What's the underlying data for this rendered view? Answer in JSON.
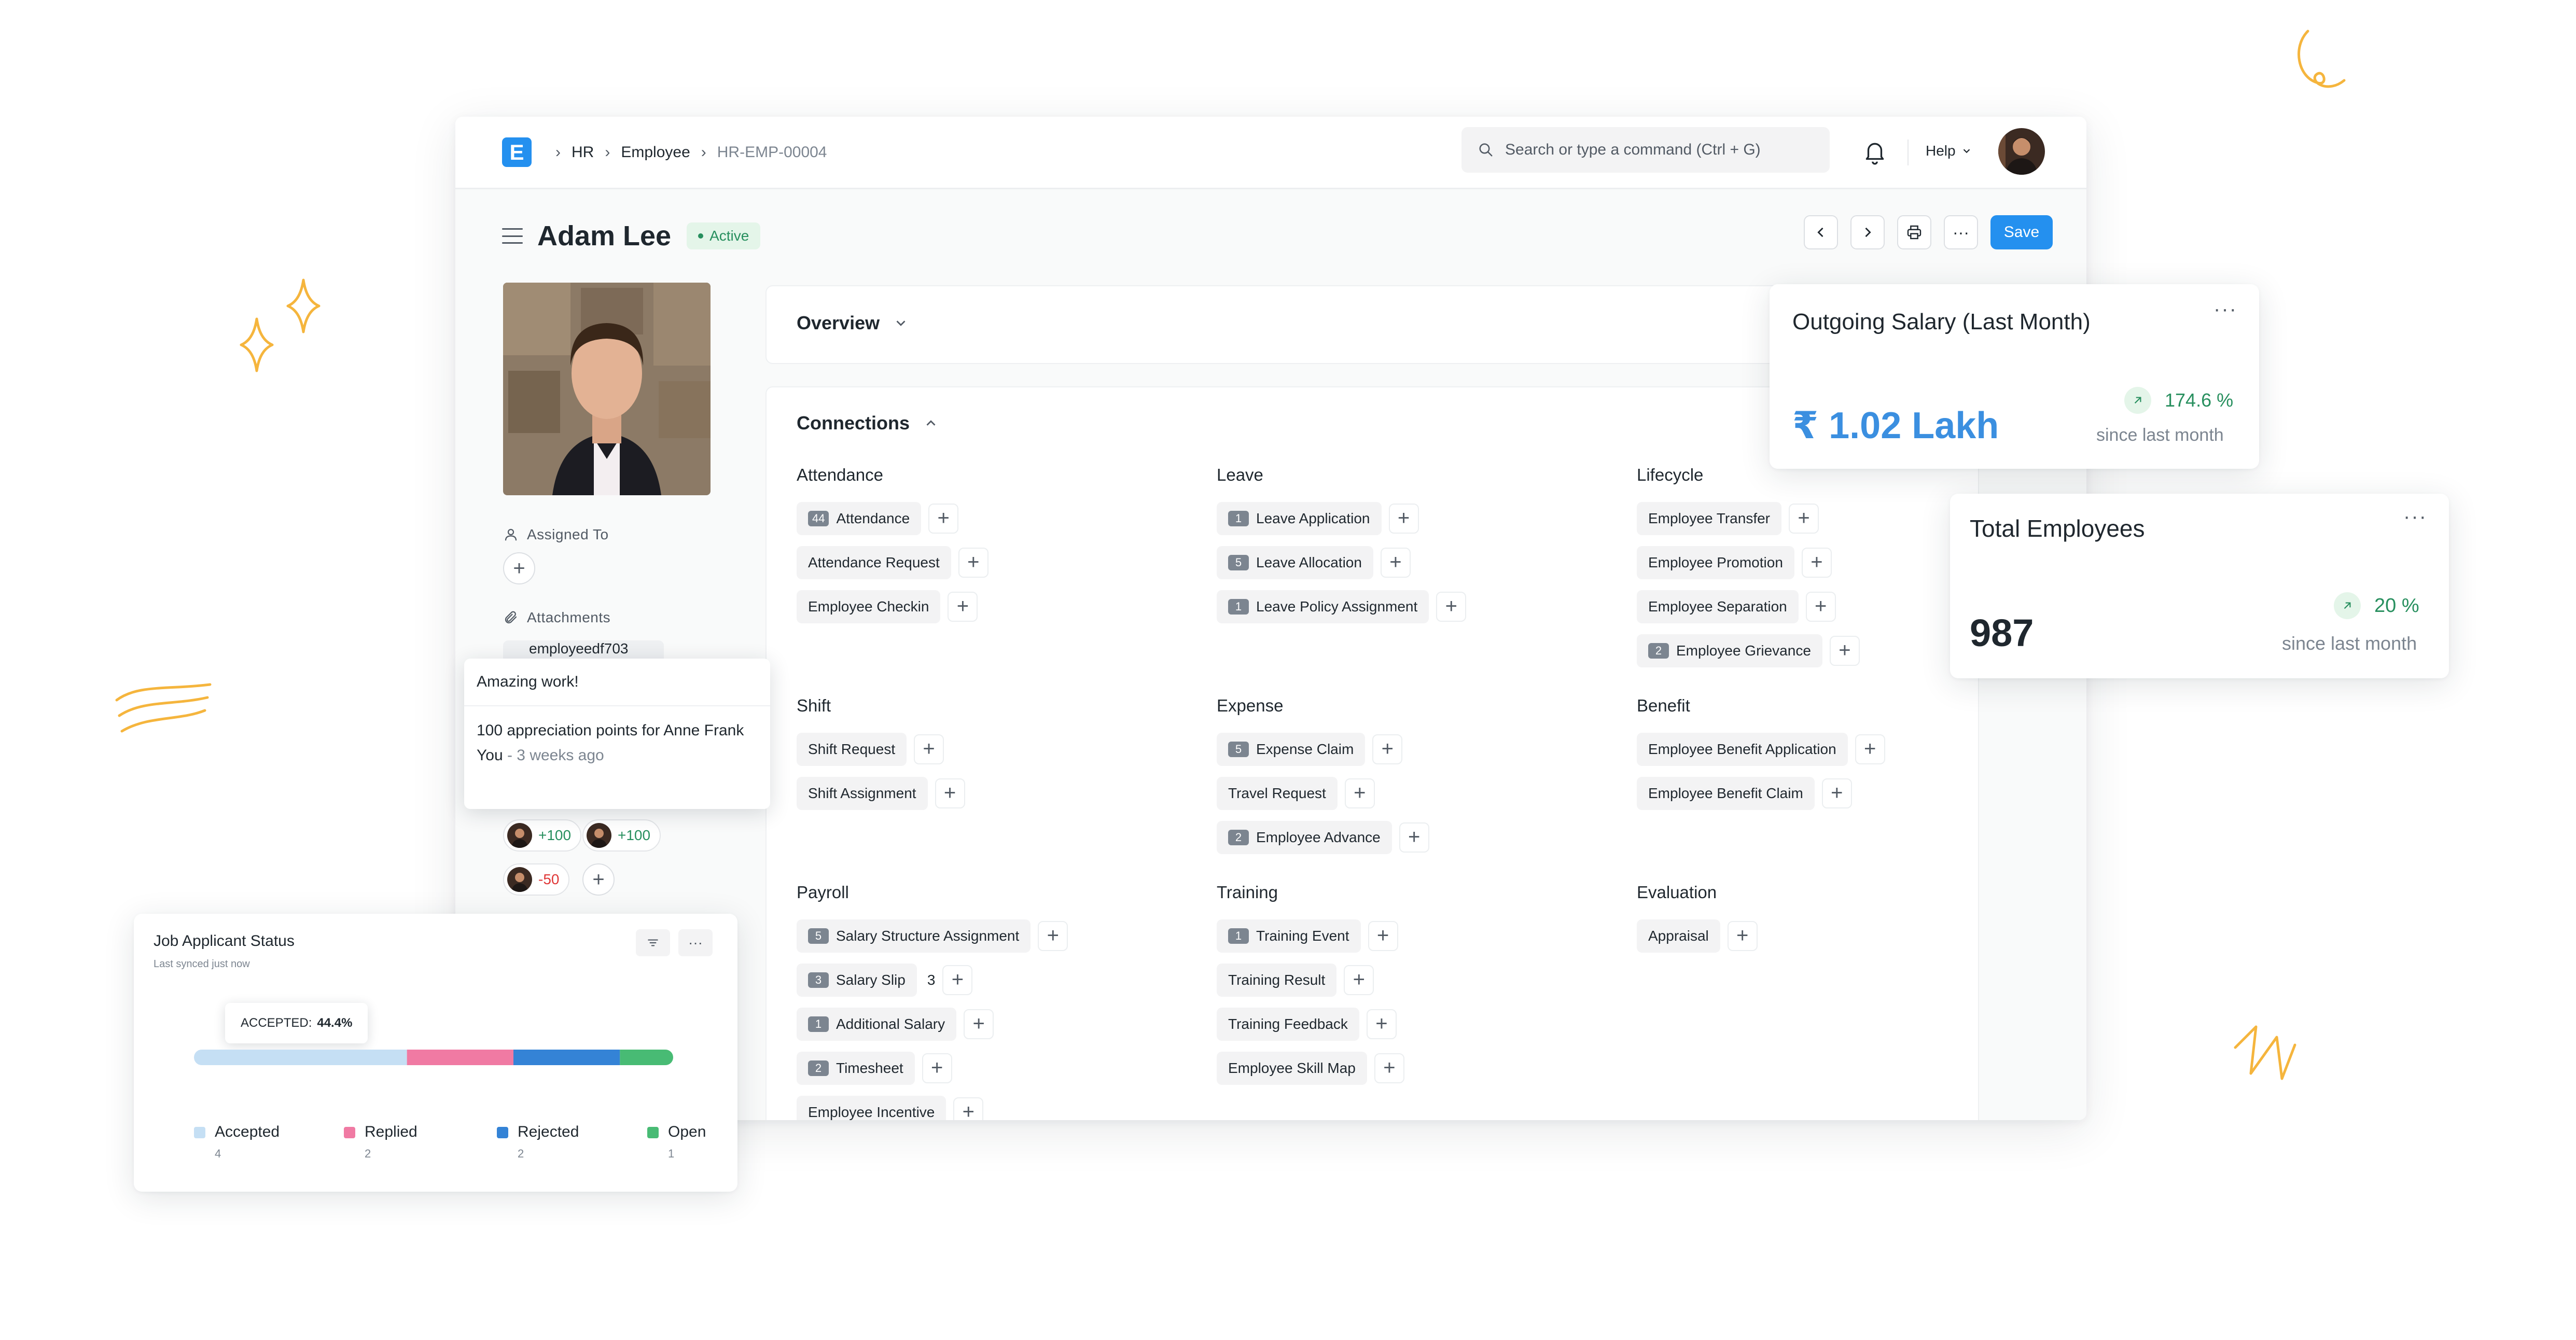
{
  "app": {
    "logo_letter": "E",
    "breadcrumbs": [
      "HR",
      "Employee",
      "HR-EMP-00004"
    ],
    "search_placeholder": "Search or type a command (Ctrl + G)",
    "help_label": "Help"
  },
  "header": {
    "title": "Adam Lee",
    "status": "Active",
    "save_label": "Save"
  },
  "sidebar": {
    "assigned_to_label": "Assigned To",
    "attachments_label": "Attachments",
    "attachment_name": "employeedf703",
    "points": [
      {
        "value": "+100",
        "color": "#278f5e"
      },
      {
        "value": "+100",
        "color": "#278f5e"
      },
      {
        "value": "-50",
        "color": "#e03636"
      }
    ]
  },
  "tooltip": {
    "title": "Amazing work!",
    "body": "100 appreciation points for Anne Frank",
    "author": "You",
    "time": "3 weeks ago"
  },
  "overview": {
    "label": "Overview"
  },
  "connections": {
    "label": "Connections",
    "groups": [
      {
        "title": "Attendance",
        "items": [
          {
            "label": "Attendance",
            "count": "44"
          },
          {
            "label": "Attendance Request"
          },
          {
            "label": "Employee Checkin"
          }
        ]
      },
      {
        "title": "Leave",
        "items": [
          {
            "label": "Leave Application",
            "count": "1"
          },
          {
            "label": "Leave Allocation",
            "count": "5"
          },
          {
            "label": "Leave Policy Assignment",
            "count": "1"
          }
        ]
      },
      {
        "title": "Lifecycle",
        "items": [
          {
            "label": "Employee Transfer"
          },
          {
            "label": "Employee Promotion"
          },
          {
            "label": "Employee Separation"
          },
          {
            "label": "Employee Grievance",
            "count": "2"
          }
        ]
      },
      {
        "title": "Shift",
        "items": [
          {
            "label": "Shift Request"
          },
          {
            "label": "Shift Assignment"
          }
        ]
      },
      {
        "title": "Expense",
        "items": [
          {
            "label": "Expense Claim",
            "count": "5"
          },
          {
            "label": "Travel Request"
          },
          {
            "label": "Employee Advance",
            "count": "2"
          }
        ]
      },
      {
        "title": "Benefit",
        "items": [
          {
            "label": "Employee Benefit Application"
          },
          {
            "label": "Employee Benefit Claim"
          }
        ]
      },
      {
        "title": "Payroll",
        "items": [
          {
            "label": "Salary Structure Assignment",
            "count": "5"
          },
          {
            "label": "Salary Slip",
            "count": "3",
            "side": "3"
          },
          {
            "label": "Additional Salary",
            "count": "1"
          },
          {
            "label": "Timesheet",
            "count": "2"
          },
          {
            "label": "Employee Incentive"
          }
        ]
      },
      {
        "title": "Training",
        "items": [
          {
            "label": "Training Event",
            "count": "1"
          },
          {
            "label": "Training Result"
          },
          {
            "label": "Training Feedback"
          },
          {
            "label": "Employee Skill Map"
          }
        ]
      },
      {
        "title": "Evaluation",
        "items": [
          {
            "label": "Appraisal"
          }
        ]
      }
    ]
  },
  "salary_card": {
    "title": "Outgoing Salary (Last Month)",
    "value": "₹ 1.02 Lakh",
    "change": "174.6 %",
    "since": "since last month"
  },
  "employees_card": {
    "title": "Total Employees",
    "value": "987",
    "change": "20 %",
    "since": "since last month"
  },
  "job_card": {
    "title": "Job Applicant Status",
    "subtitle": "Last synced just now",
    "tooltip_label": "ACCEPTED:",
    "tooltip_value": "44.4%"
  },
  "chart_data": {
    "type": "bar",
    "title": "Job Applicant Status",
    "orientation": "horizontal-stacked-percentage",
    "categories": [
      "Accepted",
      "Replied",
      "Rejected",
      "Open"
    ],
    "values": [
      4,
      2,
      2,
      1
    ],
    "colors": [
      "#c5dff4",
      "#f07aa3",
      "#3483d6",
      "#48bb74"
    ],
    "legend_position": "bottom"
  }
}
